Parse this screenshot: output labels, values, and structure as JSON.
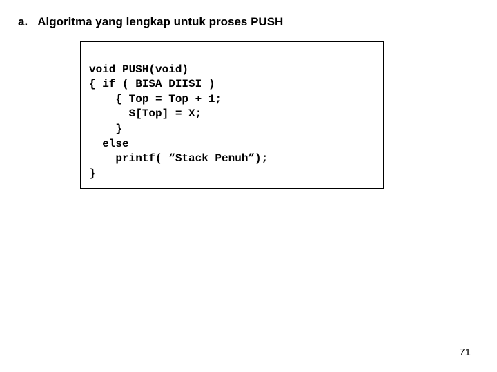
{
  "heading": {
    "label": "a.",
    "title": "Algoritma yang lengkap untuk proses PUSH"
  },
  "code": {
    "lines": [
      "void PUSH(void)",
      "{ if ( BISA DIISI )",
      "    { Top = Top + 1;",
      "      S[Top] = X;",
      "    }",
      "  else",
      "    printf( “Stack Penuh”);",
      "}"
    ]
  },
  "page_number": "71"
}
